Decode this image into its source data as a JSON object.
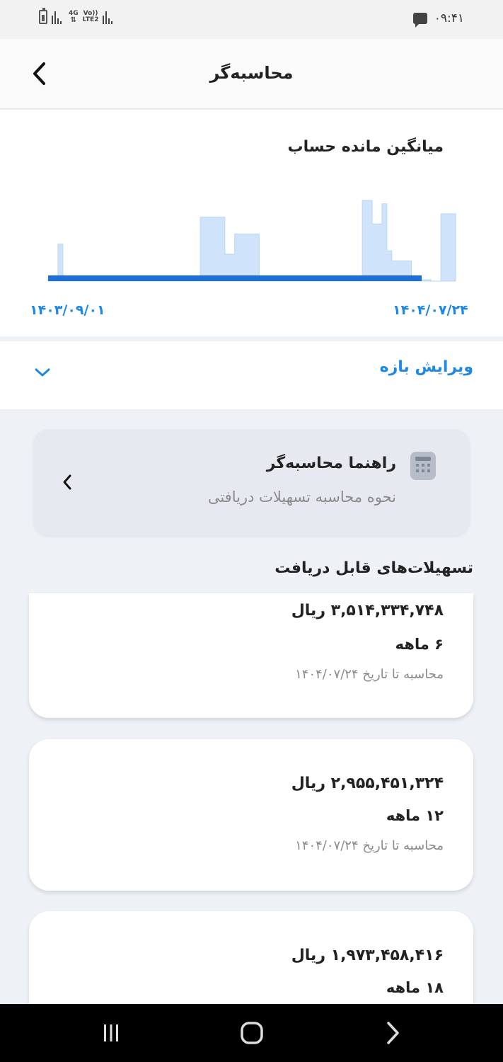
{
  "status_bar": {
    "time": "۰۹:۴۱",
    "network_top": "4G",
    "network_mid": "Vo))",
    "network_bottom": "LTE2"
  },
  "header": {
    "title": "محاسبه‌گر",
    "back_icon": "chevron-left-icon"
  },
  "balance_chart": {
    "title": "میانگین مانده حساب",
    "start_date": "۱۴۰۳/۰۹/۰۱",
    "end_date": "۱۴۰۴/۰۷/۲۴"
  },
  "chart_data": {
    "type": "area",
    "title": "میانگین مانده حساب",
    "x_start": "۱۴۰۳/۰۹/۰۱",
    "x_end": "۱۴۰۴/۰۷/۲۴",
    "values": [
      0.05,
      0.05,
      0.55,
      0.02,
      0.02,
      0.02,
      0.02,
      0.02,
      0.02,
      0.02,
      0.02,
      0.02,
      0.02,
      0.02,
      0.02,
      0.02,
      0.02,
      0.02,
      0.02,
      0.02,
      0.02,
      0.02,
      0.02,
      0.02,
      0.02,
      0.02,
      0.02,
      0.03,
      0.03,
      0.03,
      0.03,
      0.95,
      0.95,
      0.95,
      0.95,
      0.95,
      0.4,
      0.4,
      0.7,
      0.7,
      0.7,
      0.7,
      0.7,
      0.05,
      0.05,
      0.05,
      0.05,
      0.03,
      0.02,
      0.02,
      0.02,
      0.02,
      0.02,
      0.02,
      0.02,
      0.02,
      0.02,
      0.02,
      0.02,
      0.02,
      0.02,
      0.02,
      0.02,
      0.02,
      1.2,
      1.2,
      0.85,
      0.85,
      1.15,
      0.45,
      0.3,
      0.3,
      0.3,
      0.3,
      0.02,
      0.02,
      0.02,
      0.02,
      0.0,
      0.0,
      1.0,
      1.0,
      1.0,
      0.0
    ],
    "average_line": true,
    "colors": {
      "area": "#cfe3fb",
      "area_stroke": "#b9d6f7",
      "average": "#1e6fd9",
      "dim_area": "#e3eefc"
    }
  },
  "edit_range": {
    "label": "ویرایش بازه",
    "icon": "chevron-down-icon"
  },
  "guide": {
    "title": "راهنما محاسبه‌گر",
    "subtitle": "نحوه محاسبه تسهیلات دریافتی",
    "icon": "calculator-icon"
  },
  "loans_section": {
    "title": "تسهیلات‌های قابل دریافت",
    "items": [
      {
        "amount": "۳,۵۱۴,۳۳۴,۷۴۸ ریال",
        "term": "۶ ماهه",
        "calc_note": "محاسبه تا تاریخ ۱۴۰۴/۰۷/۲۴"
      },
      {
        "amount": "۲,۹۵۵,۴۵۱,۳۲۴ ریال",
        "term": "۱۲ ماهه",
        "calc_note": "محاسبه تا تاریخ ۱۴۰۴/۰۷/۲۴"
      },
      {
        "amount": "۱,۹۷۳,۴۵۸,۴۱۶ ریال",
        "term": "۱۸ ماهه",
        "calc_note": ""
      }
    ]
  },
  "nav_bar": {
    "recent_icon": "recent-apps-icon",
    "home_icon": "home-icon",
    "back_icon": "back-icon"
  },
  "accent_color": "#1e88e5"
}
